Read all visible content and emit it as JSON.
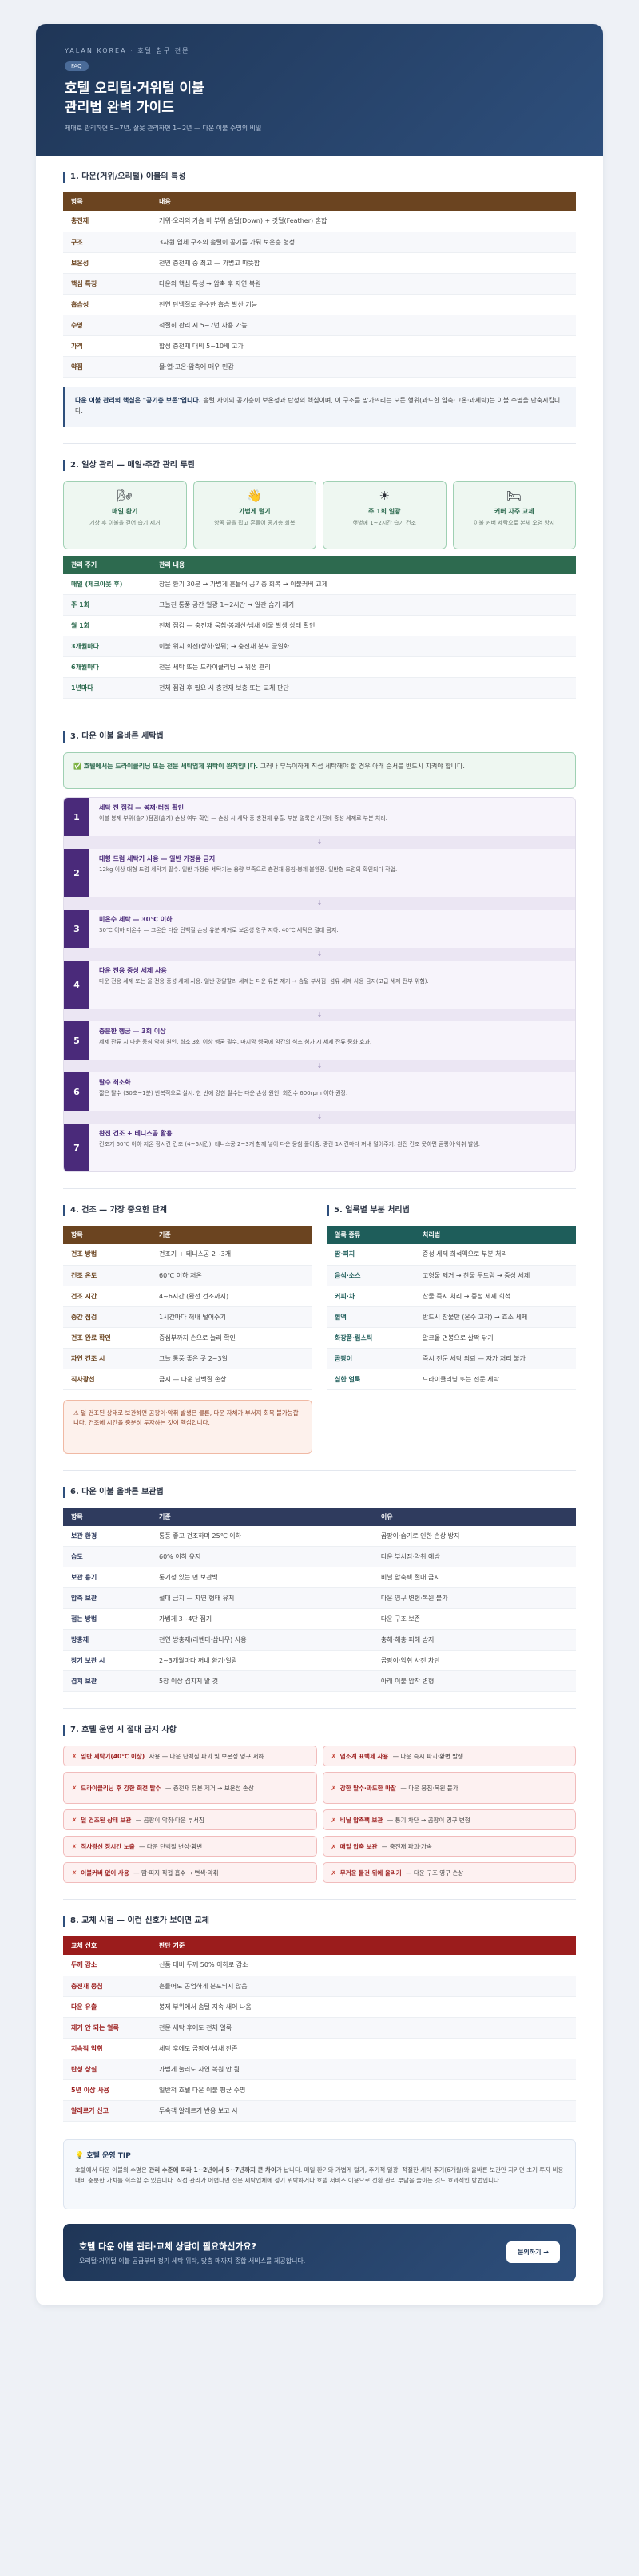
{
  "hero": {
    "brand": "YALAN KOREA · 호텔 침구 전문",
    "tag": "FAQ",
    "title_line1": "호텔 오리털·거위털 이불",
    "title_line2": "관리법 완벽 가이드",
    "subtitle": "제대로 관리하면 5~7년, 잘못 관리하면 1~2년 — 다운 이불 수명의 비밀"
  },
  "s1": {
    "title": "1. 다운(거위/오리털) 이불의 특성",
    "headers": [
      "항목",
      "내용"
    ],
    "rows": [
      [
        "충전재",
        "거위·오리의 가슴 바 부위 솜털(Down) + 깃털(Feather) 혼합"
      ],
      [
        "구조",
        "3차원 입체 구조의 솜털이 공기를 가둬 보온층 형성"
      ],
      [
        "보온성",
        "천연 충전재 중 최고 — 가볍고 따뜻함"
      ],
      [
        "핵심 특징",
        "다운의 핵심 특성 → 압축 후 자연 복원"
      ],
      [
        "흡습성",
        "천연 단백질로 우수한 흡습 발산 기능"
      ],
      [
        "수명",
        "적절히 관리 시 5~7년 사용 가능"
      ],
      [
        "가격",
        "합성 충전재 대비 5~10배 고가"
      ],
      [
        "약점",
        "물·열·고온·압축에 매우 민감"
      ]
    ],
    "note_bold": "다운 이불 관리의 핵심은 \"공기층 보존\"입니다.",
    "note_text": " 솜털 사이의 공기층이 보온성과 탄성의 핵심이며, 이 구조를 망가뜨리는 모든 행위(과도한 압축·고온·과세탁)는 이불 수명을 단축시킵니다."
  },
  "s2": {
    "title": "2. 일상 관리 — 매일·주간 관리 루틴",
    "cards": [
      {
        "icon": "🌬",
        "title": "매일 환기",
        "desc": "기상 후 이불을 걷어 습기 제거"
      },
      {
        "icon": "👋",
        "title": "가볍게 털기",
        "desc": "양쪽 끝을 잡고 흔들어 공기층 회복"
      },
      {
        "icon": "☀",
        "title": "주 1회 일광",
        "desc": "햇볕에 1~2시간 습기 건조"
      },
      {
        "icon": "🛏",
        "title": "커버 자주 교체",
        "desc": "이불 커버 세탁으로 본체 오염 방지"
      }
    ],
    "headers": [
      "관리 주기",
      "관리 내용"
    ],
    "rows": [
      [
        "매일 (체크아웃 후)",
        "창문 환기 30분 → 가볍게 흔들어 공기층 회복 → 이불커버 교체"
      ],
      [
        "주 1회",
        "그늘진 통풍 공간 일광 1~2시간 → 일관 습기 제거"
      ],
      [
        "월 1회",
        "전체 점검 — 충전재 뭉침·봉제선·냄새 이물 발생 상태 확인"
      ],
      [
        "3개월마다",
        "이불 위치 회전(상하·앞뒤) → 충전재 분포 균일화"
      ],
      [
        "6개월마다",
        "전문 세탁 또는 드라이클리닝 → 위생 관리"
      ],
      [
        "1년마다",
        "전체 점검 후 필요 시 충전재 보충 또는 교체 판단"
      ]
    ]
  },
  "s3": {
    "title": "3. 다운 이불 올바른 세탁법",
    "alert_bold": "✅ 호텔에서는 드라이클리닝 또는 전문 세탁업체 위탁이 원칙입니다.",
    "alert_text": " 그러나 부득이하게 직접 세탁해야 할 경우 아래 순서를 반드시 지켜야 합니다.",
    "steps": [
      {
        "num": "1",
        "title": "세탁 전 점검 — 봉재·터짐 확인",
        "desc": "이불 봉제 부위(솔기)점검(솔기) 손상 여부 확인 — 손상 시 세탁 중 충전재 유출. 부분 얼룩은 사전에 중성 세제로 부분 처리."
      },
      {
        "num": "2",
        "title": "대형 드럼 세탁기 사용 — 일반 가정용 금지",
        "desc": "12kg 이상 대형 드럼 세탁기 필수. 일반 가정용 세탁기는 용량 부족으로 충전재 뭉침·봉제 불완전. 일반형 드럼의 확인되다 작업."
      },
      {
        "num": "3",
        "title": "미온수 세탁 — 30℃ 이하",
        "desc": "30℃ 이하 미온수 — 고온은 다운 단백질 손상 유분 제거로 보온성 영구 저하. 40℃ 세탁은 절대 금지."
      },
      {
        "num": "4",
        "title": "다운 전용 중성 세제 사용",
        "desc": "다운 전용 세제 또는 울 전용 중성 세제 사용. 일반 강알칼리 세제는 다운 유분 제거 → 솜털 부서짐. 섬유 세제 사용 금지(고급 세제 전부 위험)."
      },
      {
        "num": "5",
        "title": "충분한 헹굼 — 3회 이상",
        "desc": "세제 잔류 시 다운 뭉침 악취 원인. 최소 3회 이상 헹굼 필수. 마지막 헹굼에 약간의 식초 첨가 시 세제 잔류 중화 효과."
      },
      {
        "num": "6",
        "title": "탈수 최소화",
        "desc": "짧은 탈수 (30초~1분) 반복적으로 실시. 한 번에 강한 탈수는 다운 손상 원인. 회전수 600rpm 이하 권장."
      },
      {
        "num": "7",
        "title": "완전 건조 + 테니스공 활용",
        "desc": "건조기 60℃ 이하 저온 장시간 건조 (4~6시간). 테니스공 2~3개 함께 넣어 다운 뭉침 풀어줌. 중간 1시간마다 꺼내 털어주기. 완전 건조 못하면 곰팡이·악취 발생."
      }
    ]
  },
  "s4": {
    "title": "4. 건조 — 가장 중요한 단계",
    "headers": [
      "항목",
      "기준"
    ],
    "rows": [
      [
        "건조 방법",
        "건조기 + 테니스공 2~3개"
      ],
      [
        "건조 온도",
        "60℃ 이하 저온"
      ],
      [
        "건조 시간",
        "4~6시간 (완전 건조까지)"
      ],
      [
        "중간 점검",
        "1시간마다 꺼내 털어주기"
      ],
      [
        "건조 완료 확인",
        "중심부까지 손으로 눌러 확인"
      ],
      [
        "자연 건조 시",
        "그늘 통풍 좋은 곳 2~3일"
      ],
      [
        "직사광선",
        "금지 — 다운 단백질 손상"
      ]
    ],
    "warn": "⚠ 덜 건조된 상태로 보관하면 곰팡이·악취 발생은 물론, 다운 자체가 부서져 회복 불가능합니다. 건조에 시간을 충분히 투자하는 것이 핵심입니다."
  },
  "s5": {
    "title": "5. 얼룩별 부분 처리법",
    "headers": [
      "얼룩 종류",
      "처리법"
    ],
    "rows": [
      [
        "땀·피지",
        "중성 세제 희석액으로 부분 처리"
      ],
      [
        "음식·소스",
        "고형물 제거 → 찬물 두드림 → 중성 세제"
      ],
      [
        "커피·차",
        "찬물 즉시 처리 → 중성 세제 희석"
      ],
      [
        "혈액",
        "반드시 찬물만 (온수 고착) → 효소 세제"
      ],
      [
        "화장품·립스틱",
        "알코올 면봉으로 살짝 닦기"
      ],
      [
        "곰팡이",
        "즉시 전문 세탁 의뢰 — 자가 처리 불가"
      ],
      [
        "심한 얼룩",
        "드라이클리닝 또는 전문 세탁"
      ]
    ]
  },
  "s6": {
    "title": "6. 다운 이불 올바른 보관법",
    "headers": [
      "항목",
      "기준",
      "이유"
    ],
    "rows": [
      [
        "보관 환경",
        "통풍 좋고 건조하며 25℃ 이하",
        "곰팡이·습기로 인한 손상 방지"
      ],
      [
        "습도",
        "60% 이하 유지",
        "다운 부서짐·악취 예방"
      ],
      [
        "보관 용기",
        "통기성 있는 면 보관백",
        "비닐 압축팩 절대 금지"
      ],
      [
        "압축 보관",
        "절대 금지 — 자연 형태 유지",
        "다운 영구 변형·복원 불가"
      ],
      [
        "접는 방법",
        "가볍게 3~4단 접기",
        "다운 구조 보존"
      ],
      [
        "방충제",
        "천연 방충제(라벤더·삼나무) 사용",
        "충해·해충 피해 방지"
      ],
      [
        "장기 보관 시",
        "2~3개월마다 꺼내 환기·일광",
        "곰팡이·악취 사전 차단"
      ],
      [
        "겹쳐 보관",
        "5장 이상 겹치지 말 것",
        "아래 이불 압착 변형"
      ]
    ]
  },
  "s7": {
    "title": "7. 호텔 운영 시 절대 금지 사항",
    "items": [
      {
        "bold": "일반 세탁기(40℃ 이상)",
        "text": " 사용 — 다운 단백질 파괴 및 보온성 영구 저하"
      },
      {
        "bold": "염소계 표백제 사용",
        "text": " — 다운 즉시 파괴·황변 발생"
      },
      {
        "bold": "드라이클리닝 후 강한 회전 탈수",
        "text": " — 충전재 유분 제거 → 보온성 손상"
      },
      {
        "bold": "강한 탈수·과도한 마찰",
        "text": " — 다운 뭉침·복원 불가"
      },
      {
        "bold": "덜 건조된 상태 보관",
        "text": " — 곰팡이·악취·다운 부서짐"
      },
      {
        "bold": "비닐 압축팩 보관",
        "text": " — 통기 차단 → 곰팡이 영구 변형"
      },
      {
        "bold": "직사광선 장시간 노출",
        "text": " — 다운 단백질 변성·황변"
      },
      {
        "bold": "매일 압축 보관",
        "text": " — 충전재 파괴·가속"
      },
      {
        "bold": "이불커버 없이 사용",
        "text": " — 땀·피지 직접 흡수 → 변색·악취"
      },
      {
        "bold": "무거운 물건 위에 올리기",
        "text": " — 다운 구조 영구 손상"
      }
    ]
  },
  "s8": {
    "title": "8. 교체 시점 — 이런 신호가 보이면 교체",
    "headers": [
      "교체 신호",
      "판단 기준"
    ],
    "rows": [
      [
        "두께 감소",
        "신품 대비 두께 50% 이하로 감소"
      ],
      [
        "충전재 뭉침",
        "흔들어도 공업하게 분포되지 않음"
      ],
      [
        "다운 유출",
        "봉제 부위에서 솜털 지속 새어 나옴"
      ],
      [
        "제거 안 되는 얼룩",
        "전문 세탁 후에도 전체 얼룩"
      ],
      [
        "지속적 악취",
        "세탁 후에도 곰팡이·냄새 잔존"
      ],
      [
        "탄성 상실",
        "가볍게 눌러도 자연 복원 안 됨"
      ],
      [
        "5년 이상 사용",
        "일반적 호텔 다운 이불 평균 수명"
      ],
      [
        "알레르기 신고",
        "투숙객 알레르기 반응 보고 시"
      ]
    ]
  },
  "tip": {
    "title": "💡 호텔 운영 TIP",
    "text_a": "호텔에서 다운 이불의 수명은 ",
    "text_bold": "관리 수준에 따라 1~2년에서 5~7년까지 큰 차이",
    "text_b": "가 납니다. 매일 환기와 가볍게 털기, 주기적 일광, 적절한 세탁 주기(6개월)와 올바른 보관만 지키면 초기 투자 비용 대비 충분한 가치를 회수할 수 있습니다. 직접 관리가 어렵다면 전문 세탁업체에 정기 위탁하거나 호텔 서비스 이용으로 전환 관리 부담을 줄이는 것도 효과적인 방법입니다."
  },
  "cta": {
    "title": "호텔 다운 이불 관리·교체 상담이 필요하신가요?",
    "subtitle": "오리털·거위털 이불 공급부터 정기 세탁 위탁, 맞춤 매까지 종합 서비스를 제공합니다.",
    "button": "문의하기 →"
  },
  "colors": {
    "hero": "#1f3657",
    "brown": "#6b4420",
    "green": "#2d6a4f",
    "purple": "#4a2a7a",
    "red": "#9b1c1c",
    "teal": "#1e5d5a",
    "navy": "#2f3b5e"
  }
}
